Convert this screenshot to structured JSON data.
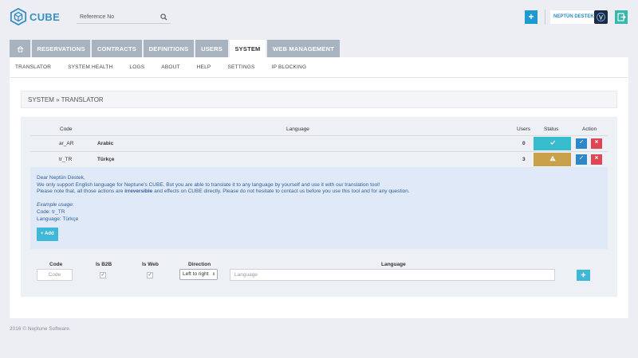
{
  "app": {
    "logo_text": "CUBE"
  },
  "search": {
    "placeholder": "Reference No"
  },
  "header": {
    "plus_label": "+",
    "user_name": "NEPTÜN DESTEK"
  },
  "tabs": [
    {
      "label": "RESERVATIONS"
    },
    {
      "label": "CONTRACTS"
    },
    {
      "label": "DEFINITIONS"
    },
    {
      "label": "USERS"
    },
    {
      "label": "SYSTEM"
    },
    {
      "label": "WEB MANAGEMENT"
    }
  ],
  "subnav": [
    {
      "label": "TRANSLATOR"
    },
    {
      "label": "SYSTEM HEALTH"
    },
    {
      "label": "LOGS"
    },
    {
      "label": "ABOUT"
    },
    {
      "label": "HELP"
    },
    {
      "label": "SETTINGS"
    },
    {
      "label": "IP BLOCKING"
    }
  ],
  "breadcrumb": "SYSTEM » TRANSLATOR",
  "table": {
    "headers": {
      "code": "Code",
      "language": "Language",
      "users": "Users",
      "status": "Status",
      "action": "Action"
    },
    "rows": [
      {
        "code": "ar_AR",
        "language": "Arabic",
        "users": "0",
        "status": "ok",
        "status_color": "#36bccd"
      },
      {
        "code": "tr_TR",
        "language": "Türkçe",
        "users": "3",
        "status": "warning",
        "status_color": "#c9a14a"
      }
    ]
  },
  "info": {
    "greeting": "Dear Neptün Destek,",
    "line1": "We only support English language for Neptune's CUBE. But you are able to translate it to any language by yourself and use it with our translation tool!",
    "line2_a": "Please note that, all those actions are ",
    "line2_b": "irreversible",
    "line2_c": " and effects on CUBE directly. Please do not hesitate to contact us before you use this tool and for any question.",
    "example_title": "Example usage:",
    "example_code": "Code: tr_TR",
    "example_lang": "Language: Türkçe",
    "add_label": "+ Add"
  },
  "form": {
    "headers": {
      "code": "Code",
      "is_b2b": "Is B2B",
      "is_web": "Is Web",
      "direction": "Direction",
      "language": "Language"
    },
    "code_placeholder": "Code",
    "direction_value": "Left to right",
    "language_placeholder": "Language",
    "is_b2b": true,
    "is_web": true
  },
  "footer": "2016 © Neptune Software.",
  "colors": {
    "accent": "#1d9bd1",
    "tab_inactive": "#a8b3c0",
    "delete": "#e04555",
    "edit": "#2e87c6"
  }
}
